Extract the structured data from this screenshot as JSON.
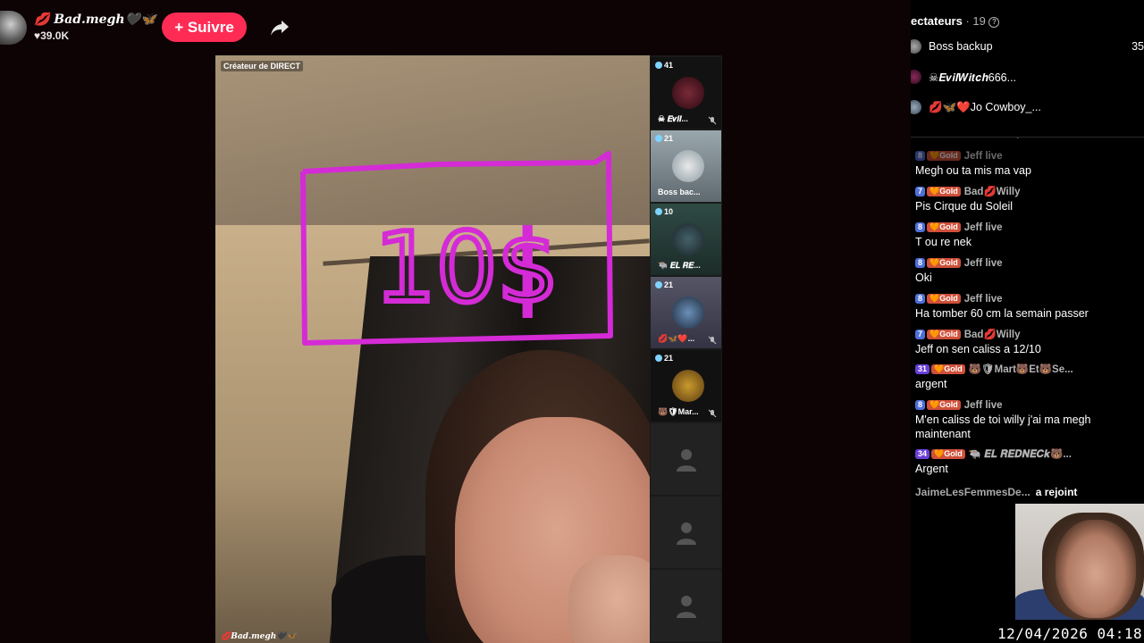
{
  "host": {
    "name": "💋 Bad.megh🖤🦋",
    "likes": "♥39.0K",
    "follow_label": "+ Suivre"
  },
  "video": {
    "creator_tag": "Créateur de DIRECT",
    "drawn_text": "10$",
    "footer_name": "💋Bad.megh🖤🦋"
  },
  "guests": [
    {
      "count": "41",
      "name": "☠ 𝑬𝒗𝒊𝒍...",
      "muted": true
    },
    {
      "count": "21",
      "name": "Boss bac...",
      "muted": false
    },
    {
      "count": "10",
      "name": "🐃 𝑬𝑳 𝑹𝑬...",
      "muted": false
    },
    {
      "count": "21",
      "name": "💋🦋❤️...",
      "muted": true
    },
    {
      "count": "21",
      "name": "🐻🛡Mar...",
      "muted": true
    }
  ],
  "viewers": {
    "header": "ectateurs",
    "count": "· 19",
    "list": [
      {
        "name": "Boss backup",
        "score": "35"
      },
      {
        "name": "☠𝑬𝒗𝒊𝒍𝑾𝒊𝒕𝒄𝒉666...",
        "score": ""
      },
      {
        "name": "💋🦋❤️Jo Cowboy_...",
        "score": ""
      }
    ]
  },
  "chat": [
    {
      "level": "8",
      "badge": "🧡Gold",
      "user": "Jeff live",
      "text": "Megh ou ta mis ma vap",
      "faded": true
    },
    {
      "level": "7",
      "badge": "🧡Gold",
      "user": "Bad💋Willy",
      "text": "Pis Cirque du Soleil"
    },
    {
      "level": "8",
      "badge": "🧡Gold",
      "user": "Jeff live",
      "text": "T ou re nek"
    },
    {
      "level": "8",
      "badge": "🧡Gold",
      "user": "Jeff live",
      "text": "Oki"
    },
    {
      "level": "8",
      "badge": "🧡Gold",
      "user": "Jeff live",
      "text": "Ha tomber 60 cm la semain passer"
    },
    {
      "level": "7",
      "badge": "🧡Gold",
      "user": "Bad💋Willy",
      "text": "Jeff on sen caliss a 12/10"
    },
    {
      "level": "31",
      "badge": "🧡Gold",
      "user": "🐻🛡Mart🐻Et🐻Se...",
      "text": "argent",
      "purple": true
    },
    {
      "level": "8",
      "badge": "🧡Gold",
      "user": "Jeff live",
      "text": "M'en caliss de toi willy j'ai ma megh maintenant"
    },
    {
      "level": "34",
      "badge": "🧡Gold",
      "user": "🐃 𝑬𝑳 𝑹𝑬𝑫𝑵𝑬𝑪𝒌🐻...",
      "text": "Argent",
      "purple": true
    }
  ],
  "join_event": {
    "user": "JaimeLesFemmesDe...",
    "text": "a rejoint"
  },
  "overlay": {
    "timestamp": "12/04/2026 04:18"
  },
  "colors": {
    "follow": "#fe2c55",
    "drawing": "#d42bd6",
    "level": "#4f6fd8",
    "gold_badge": "#d0503a"
  }
}
